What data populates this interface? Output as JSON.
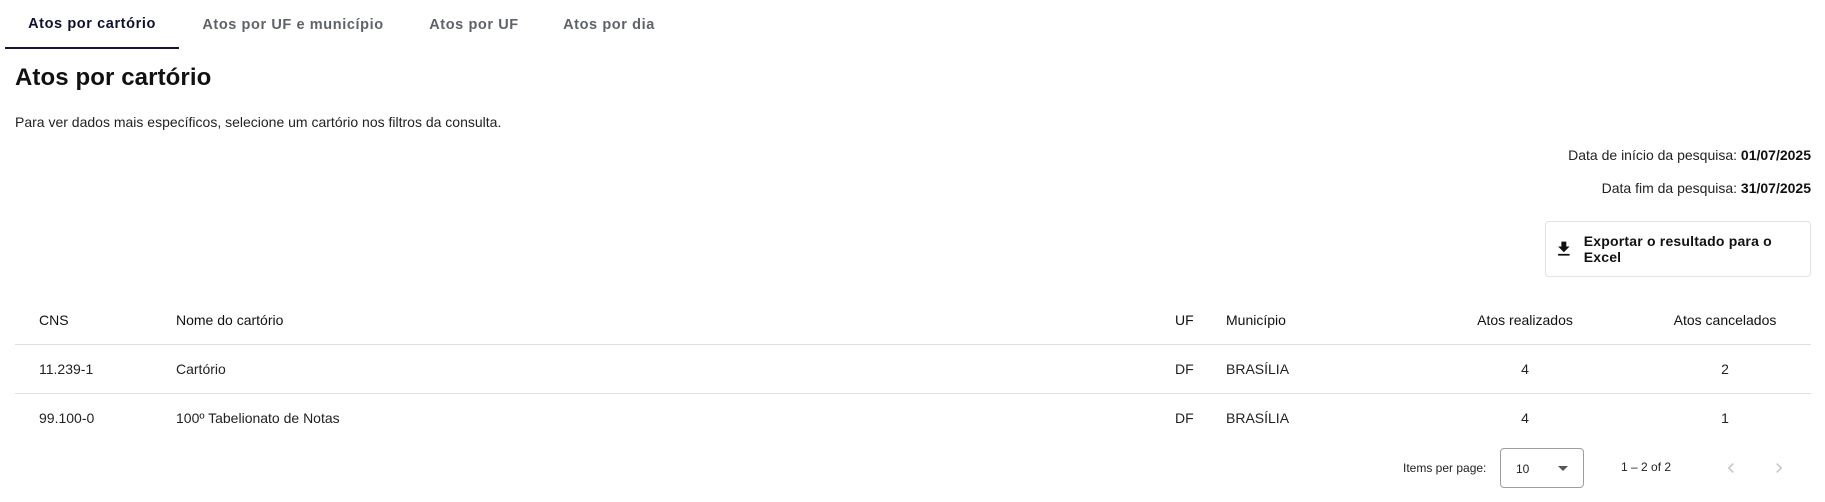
{
  "tabs": [
    {
      "label": "Atos por cartório",
      "active": true
    },
    {
      "label": "Atos por UF e município",
      "active": false
    },
    {
      "label": "Atos por UF",
      "active": false
    },
    {
      "label": "Atos por dia",
      "active": false
    }
  ],
  "page": {
    "title": "Atos por cartório",
    "subtitle": "Para ver dados mais específicos, selecione um cartório nos filtros da consulta."
  },
  "dates": {
    "start_label": "Data de início da pesquisa:",
    "start_value": "01/07/2025",
    "end_label": "Data fim da pesquisa:",
    "end_value": "31/07/2025"
  },
  "export": {
    "label": "Exportar o resultado para o Excel",
    "icon": "download-icon"
  },
  "table": {
    "headers": {
      "cns": "CNS",
      "nome": "Nome do cartório",
      "uf": "UF",
      "municipio": "Município",
      "realizados": "Atos realizados",
      "cancelados": "Atos cancelados"
    },
    "rows": [
      {
        "cns": "11.239-1",
        "nome": "Cartório",
        "uf": "DF",
        "municipio": "BRASÍLIA",
        "realizados": "4",
        "cancelados": "2"
      },
      {
        "cns": "99.100-0",
        "nome": "100º Tabelionato de Notas",
        "uf": "DF",
        "municipio": "BRASÍLIA",
        "realizados": "4",
        "cancelados": "1"
      }
    ]
  },
  "paginator": {
    "items_per_page_label": "Items per page:",
    "items_per_page_value": "10",
    "range": "1 – 2 of 2",
    "prev_icon": "chevron-left-icon",
    "next_icon": "chevron-right-icon"
  },
  "colors": {
    "active_tab": "#14143a",
    "border": "#e0e0e0",
    "disabled_icon": "#c8c8c8"
  }
}
